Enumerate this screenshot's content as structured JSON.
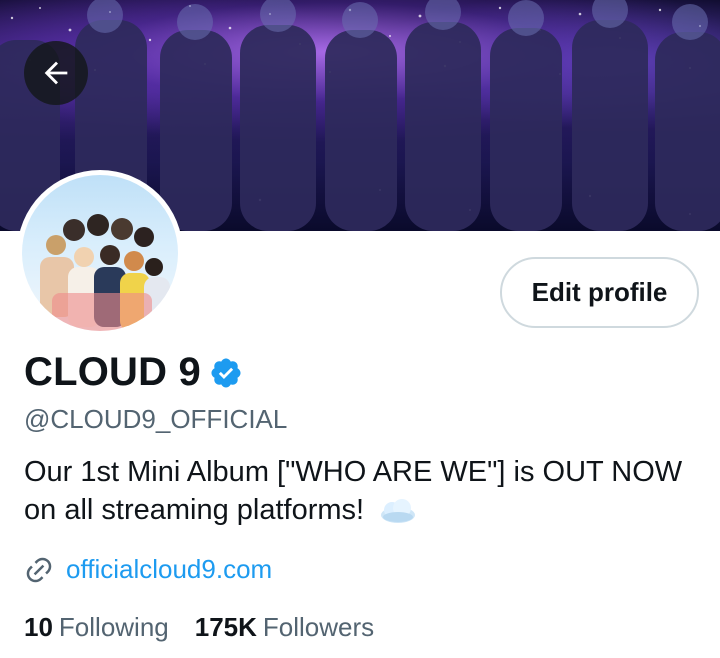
{
  "header": {
    "back_icon": "arrow-left-icon"
  },
  "profile": {
    "name": "CLOUD 9",
    "verified_icon": "verified-badge-icon",
    "handle": "@CLOUD9_OFFICIAL",
    "bio": "Our 1st Mini Album [\"WHO ARE WE\"] is OUT NOW on all streaming platforms!",
    "bio_emoji_icon": "cloud-icon",
    "website_icon": "link-icon",
    "website": "officialcloud9.com",
    "edit_button_label": "Edit profile"
  },
  "stats": {
    "following_count": "10",
    "following_label": "Following",
    "followers_count": "175K",
    "followers_label": "Followers"
  },
  "colors": {
    "accent": "#1d9bf0",
    "text_primary": "#0f1419",
    "text_secondary": "#536471",
    "border": "#cfd9de"
  }
}
